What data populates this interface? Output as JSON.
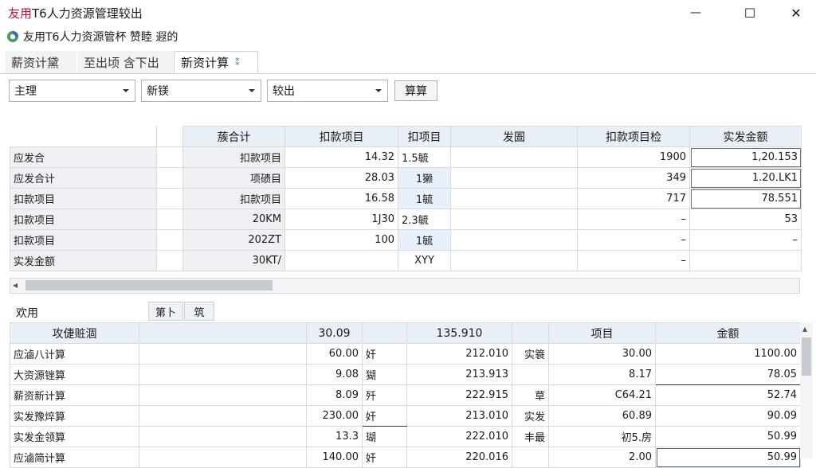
{
  "window": {
    "title_brand": "友用",
    "title_rest": "T6人力资源管理较出",
    "minimize_glyph": "—",
    "maximize_glyph": "☐",
    "close_glyph": "✕"
  },
  "breadcrumb": {
    "text": "友用T6人力资源管杯 赞睦 遐的"
  },
  "tabs": [
    {
      "label": "薪资计黛"
    },
    {
      "label": "至出顷  含下出"
    },
    {
      "label": "新资计算"
    }
  ],
  "tab_pin_glyph": "⁑",
  "filters": {
    "sel1": "主理",
    "sel2": "新镁",
    "sel3": "较出",
    "button": "算算"
  },
  "grid1": {
    "headers": [
      "",
      "",
      "蔟合计",
      "扣款项目",
      "扣项目",
      "发圄",
      "扣款项目检",
      "实发金额"
    ],
    "rows": [
      [
        "应发合",
        "",
        "扣款项目",
        "14.32",
        "1.5毓",
        "",
        "1900",
        "1,20.153"
      ],
      [
        "应发合计",
        "",
        "项碛目",
        "28.03",
        "1獭",
        "",
        "349",
        "1.20.LK1"
      ],
      [
        "扣款项目",
        "",
        "扣款项目",
        "16.58",
        "1毓",
        "",
        "717",
        "78.551"
      ],
      [
        "扣款项目",
        "",
        "20KM",
        "1J30",
        "2.3毓",
        "",
        "–",
        "53"
      ],
      [
        "扣款项目",
        "",
        "202ZT",
        "100",
        "1毓",
        "",
        "–",
        "–"
      ],
      [
        "实发金额",
        "",
        "30KT/",
        "",
        "XYY",
        "",
        "–",
        ""
      ]
    ],
    "scroll_left_glyph": "◂"
  },
  "section2": {
    "label": "欢用",
    "subtabs": [
      "第卜",
      "筑"
    ]
  },
  "grid2": {
    "headers": [
      "攻倢赃涸",
      "",
      "30.09",
      "",
      "135.910",
      "",
      "项目",
      "金额"
    ],
    "rows": [
      [
        "应滷八计算",
        "",
        "60.00",
        "奸",
        "212.010",
        "实簑",
        "30.00",
        "1100.00"
      ],
      [
        "大资源锉算",
        "",
        "9.08",
        "猢",
        "213.913",
        "",
        "8.17",
        "78.05"
      ],
      [
        "薪资新计算",
        "",
        "8.09",
        "歼",
        "222.915",
        "草",
        "C64.21",
        "52.74"
      ],
      [
        "实发豫焠算",
        "",
        "230.00",
        "奸",
        "213.010",
        "实发",
        "60.89",
        "90.09"
      ],
      [
        "实发金领算",
        "",
        "13.3",
        "瑚",
        "222.010",
        "丰最",
        "初5.房",
        "50.99"
      ],
      [
        "应滷简计算",
        "",
        "140.00",
        "奸",
        "220.016",
        "",
        "2.00",
        "50.99"
      ]
    ],
    "scroll_up_glyph": "▴"
  }
}
